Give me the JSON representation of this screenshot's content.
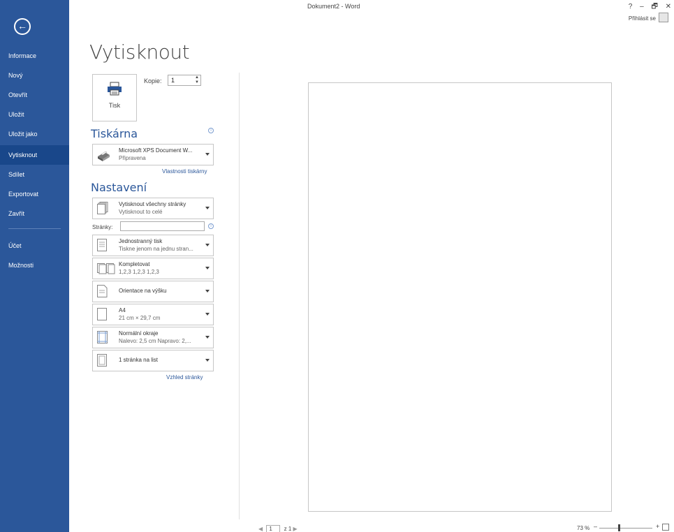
{
  "window": {
    "title": "Dokument2 - Word",
    "help": "?",
    "minimize": "–",
    "restore": "🗗",
    "close": "✕",
    "signin": "Přihlásit se"
  },
  "sidebar": {
    "back": "←",
    "items": [
      {
        "label": "Informace"
      },
      {
        "label": "Nový"
      },
      {
        "label": "Otevřít"
      },
      {
        "label": "Uložit"
      },
      {
        "label": "Uložit jako"
      },
      {
        "label": "Vytisknout",
        "active": true
      },
      {
        "label": "Sdílet"
      },
      {
        "label": "Exportovat"
      },
      {
        "label": "Zavřít"
      },
      {
        "label": "Účet"
      },
      {
        "label": "Možnosti"
      }
    ]
  },
  "print": {
    "title": "Vytisknout",
    "button_label": "Tisk",
    "copies_label": "Kopie:",
    "copies_value": "1"
  },
  "printer": {
    "heading": "Tiskárna",
    "name": "Microsoft XPS Document W...",
    "status": "Připravena",
    "properties_link": "Vlastnosti tiskárny"
  },
  "settings": {
    "heading": "Nastavení",
    "pages_label": "Stránky:",
    "pages_value": "",
    "cards": [
      {
        "l1": "Vytisknout všechny stránky",
        "l2": "Vytisknout to celé"
      },
      {
        "l1": "Jednostranný tisk",
        "l2": "Tiskne jenom na jednu stran..."
      },
      {
        "l1": "Kompletovat",
        "l2": "1,2,3   1,2,3   1,2,3"
      },
      {
        "single": "Orientace na výšku"
      },
      {
        "l1": "A4",
        "l2": "21 cm × 29,7 cm"
      },
      {
        "l1": "Normální okraje",
        "l2": "Nalevo: 2,5 cm   Napravo: 2,..."
      },
      {
        "single": "1 stránka na list"
      }
    ],
    "page_setup_link": "Vzhled stránky"
  },
  "preview": {
    "page_current": "1",
    "page_of": "z 1",
    "zoom": "73 %",
    "zoom_minus": "–",
    "zoom_plus": "+"
  }
}
